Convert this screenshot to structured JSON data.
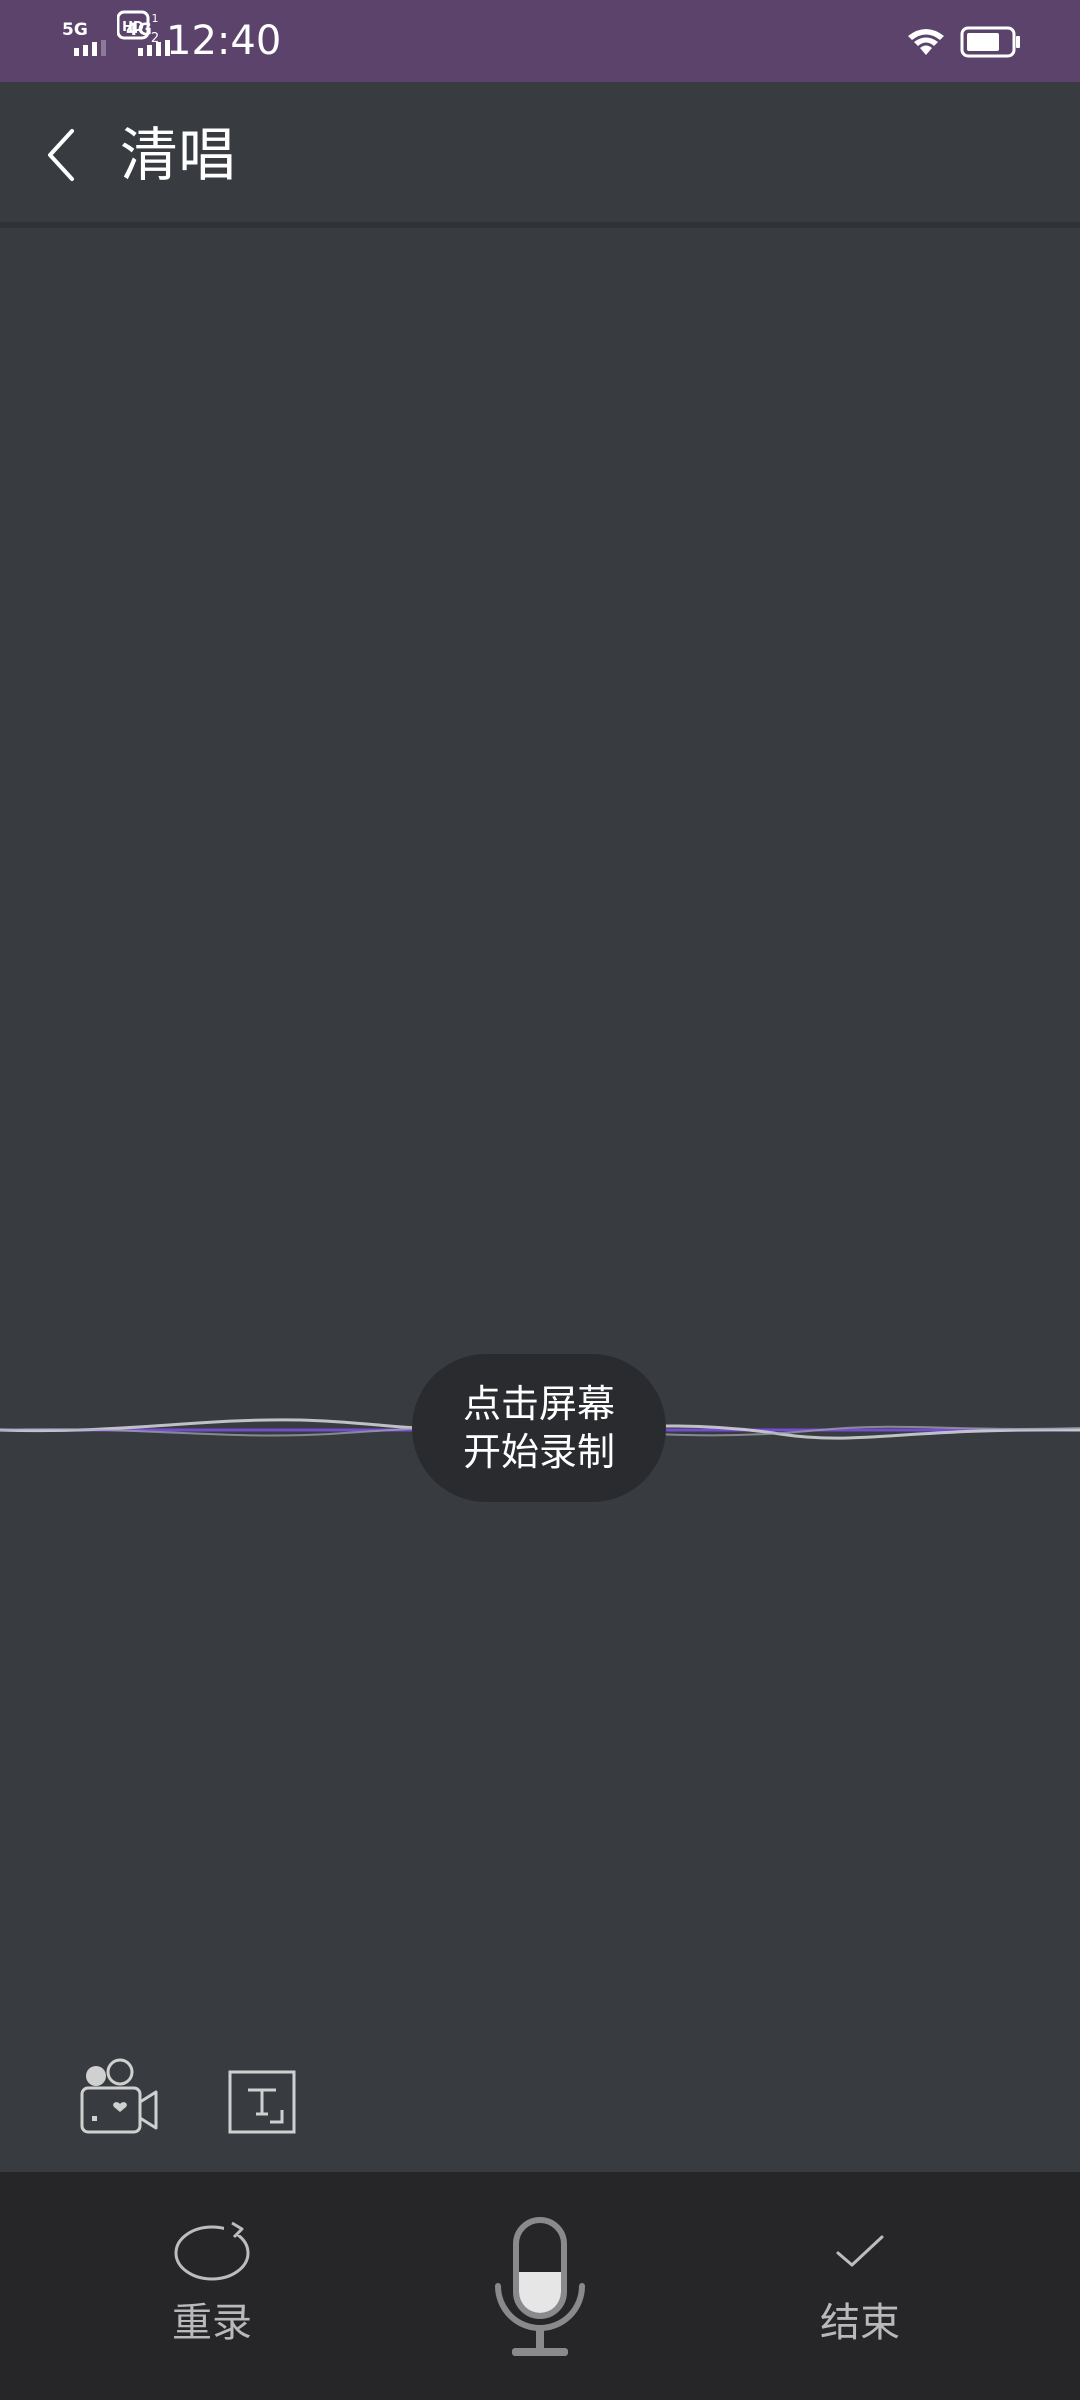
{
  "status_bar": {
    "network_1": "5G",
    "network_2": "4G",
    "hd_badge": "HD",
    "hd_sub": "2",
    "time": "12:40",
    "icons": [
      "signal-5g-icon",
      "signal-4g-icon",
      "hd-voice-icon",
      "wifi-icon",
      "battery-icon"
    ],
    "background_color": "#5b436b"
  },
  "header": {
    "title": "清唱",
    "back_icon": "chevron-left-icon"
  },
  "stage": {
    "hint_line1": "点击屏幕",
    "hint_line2": "开始录制",
    "wave_color": "#7b4fe0",
    "background_color": "#383c41"
  },
  "tools": {
    "video_icon": "video-camera-icon",
    "text_icon": "text-lyrics-icon"
  },
  "bottom_bar": {
    "redo_label": "重录",
    "redo_icon": "rerecord-icon",
    "mic_icon": "microphone-icon",
    "finish_label": "结束",
    "finish_icon": "check-icon"
  }
}
